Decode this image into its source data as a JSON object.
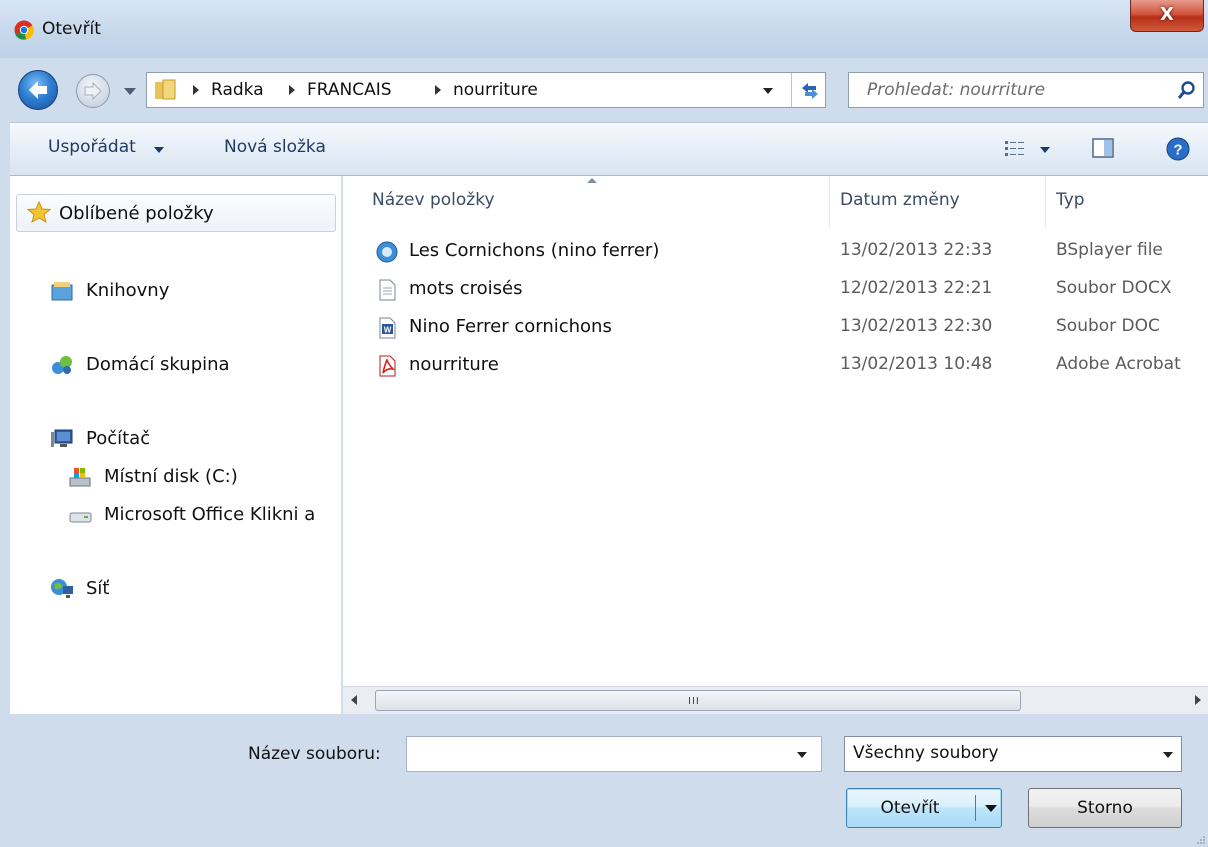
{
  "window": {
    "title": "Otevřít",
    "close_label": "X"
  },
  "address": {
    "crumbs": [
      "Radka",
      "FRANCAIS",
      "nourriture"
    ],
    "search_placeholder": "Prohledat: nourriture"
  },
  "toolbar": {
    "organize": "Uspořádat",
    "new_folder": "Nová složka"
  },
  "nav": {
    "favorites": "Oblíbené položky",
    "libraries": "Knihovny",
    "homegroup": "Domácí skupina",
    "computer": "Počítač",
    "local_disk": "Místní disk (C:)",
    "office_drive": "Microsoft Office Klikni a",
    "network": "Síť"
  },
  "columns": {
    "name": "Název položky",
    "date": "Datum změny",
    "type": "Typ"
  },
  "files": [
    {
      "name": "Les Cornichons (nino ferrer)",
      "date": "13/02/2013 22:33",
      "type": "BSplayer file",
      "icon": "bsplayer-icon"
    },
    {
      "name": "mots croisés",
      "date": "12/02/2013 22:21",
      "type": "Soubor DOCX",
      "icon": "document-icon"
    },
    {
      "name": "Nino Ferrer cornichons",
      "date": "13/02/2013 22:30",
      "type": "Soubor DOC",
      "icon": "word-icon"
    },
    {
      "name": "nourriture",
      "date": "13/02/2013 10:48",
      "type": "Adobe Acrobat",
      "icon": "pdf-icon"
    }
  ],
  "scrollbar_grip": "III",
  "bottom": {
    "filename_label": "Název souboru:",
    "filename_value": "",
    "filetype_value": "Všechny soubory",
    "open_label": "Otevřít",
    "cancel_label": "Storno"
  },
  "colors": {
    "accent": "#3c7fb1",
    "close": "#c8442c",
    "frame": "#cfdcec"
  }
}
